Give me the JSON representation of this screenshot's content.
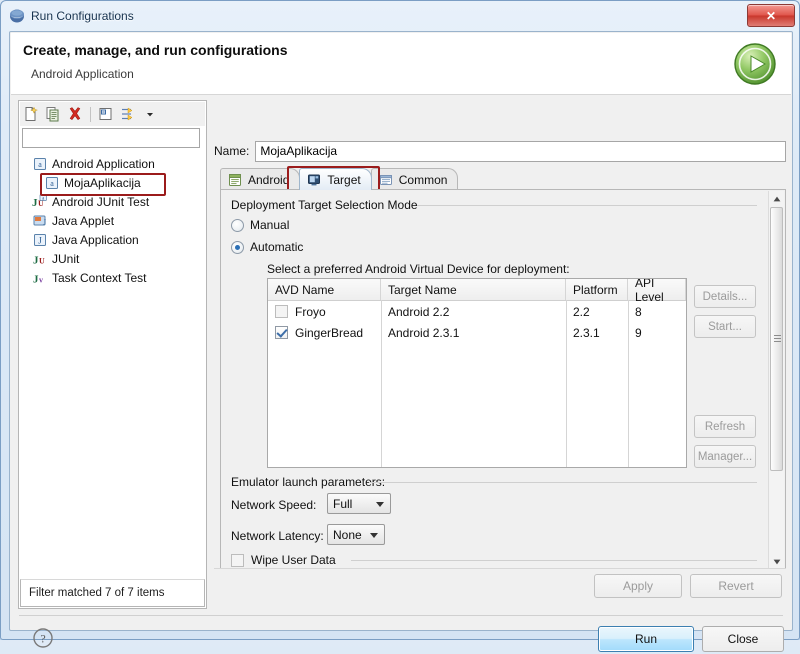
{
  "window": {
    "title": "Run Configurations",
    "title_icon": "eclipse-run-icon",
    "close_label": "✕"
  },
  "header": {
    "title": "Create, manage, and run configurations",
    "subtitle": "Android Application",
    "icon": "green-run-play-icon"
  },
  "toolbar": {
    "buttons": [
      {
        "name": "new-configuration-icon",
        "label": "New"
      },
      {
        "name": "duplicate-configuration-icon",
        "label": "Duplicate"
      },
      {
        "name": "delete-configuration-icon",
        "label": "Delete"
      },
      {
        "name": "collapse-all-icon",
        "label": "Collapse All"
      },
      {
        "name": "filter-icon",
        "label": "Filter"
      },
      {
        "name": "chevron-down-icon",
        "label": "Menu"
      }
    ]
  },
  "filter": {
    "value": "",
    "placeholder": "",
    "status": "Filter matched 7 of 7 items"
  },
  "tree": {
    "items": [
      {
        "label": "Android Application",
        "icon": "android-app-icon",
        "indent": false,
        "selected": false,
        "highlighted": false
      },
      {
        "label": "MojaAplikacija",
        "icon": "android-app-icon",
        "indent": true,
        "selected": true,
        "highlighted": true
      },
      {
        "label": "Android JUnit Test",
        "icon": "android-junit-icon",
        "indent": false,
        "selected": false,
        "highlighted": false
      },
      {
        "label": "Java Applet",
        "icon": "java-applet-icon",
        "indent": false,
        "selected": false,
        "highlighted": false
      },
      {
        "label": "Java Application",
        "icon": "java-app-icon",
        "indent": false,
        "selected": false,
        "highlighted": false
      },
      {
        "label": "JUnit",
        "icon": "junit-icon",
        "indent": false,
        "selected": false,
        "highlighted": false
      },
      {
        "label": "Task Context Test",
        "icon": "task-context-icon",
        "indent": false,
        "selected": false,
        "highlighted": false
      }
    ]
  },
  "name_field": {
    "label": "Name:",
    "value": "MojaAplikacija",
    "placeholder": ""
  },
  "tabs": [
    {
      "label": "Android",
      "icon": "android-tab-icon",
      "active": false,
      "highlighted": false
    },
    {
      "label": "Target",
      "icon": "target-device-icon",
      "active": true,
      "highlighted": true
    },
    {
      "label": "Common",
      "icon": "common-tab-icon",
      "active": false,
      "highlighted": false
    }
  ],
  "target_tab": {
    "group_label": "Deployment Target Selection Mode",
    "radios": [
      {
        "label": "Manual",
        "checked": false
      },
      {
        "label": "Automatic",
        "checked": true
      }
    ],
    "hint": "Select a preferred Android Virtual Device for deployment:",
    "table": {
      "columns": [
        "AVD Name",
        "Target Name",
        "Platform",
        "API Level"
      ],
      "rows": [
        {
          "checked": false,
          "avd_name": "Froyo",
          "target_name": "Android 2.2",
          "platform": "2.2",
          "api_level": "8"
        },
        {
          "checked": true,
          "avd_name": "GingerBread",
          "target_name": "Android 2.3.1",
          "platform": "2.3.1",
          "api_level": "9"
        }
      ]
    },
    "side_buttons": [
      {
        "label": "Details...",
        "name": "details-button"
      },
      {
        "label": "Start...",
        "name": "start-button"
      },
      {
        "label": "Refresh",
        "name": "refresh-button"
      },
      {
        "label": "Manager...",
        "name": "manager-button"
      }
    ],
    "emulator": {
      "group_label": "Emulator launch parameters:",
      "network_speed": {
        "label": "Network Speed:",
        "value": "Full"
      },
      "network_latency": {
        "label": "Network Latency:",
        "value": "None"
      },
      "wipe_user_data": {
        "label": "Wipe User Data",
        "checked": false
      }
    }
  },
  "actions": {
    "apply": "Apply",
    "revert": "Revert",
    "run": "Run",
    "close": "Close",
    "help_icon": "help-question-icon"
  },
  "colors": {
    "highlight": "#9b1b1b",
    "accent": "#3c7fb1",
    "close_red": "#c9372c",
    "run_green": "#6db33f"
  }
}
